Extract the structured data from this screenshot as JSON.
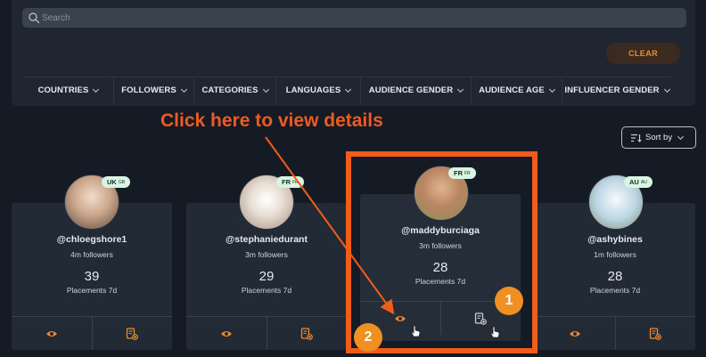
{
  "search": {
    "placeholder": "Search"
  },
  "filters": {
    "clear_label": "CLEAR",
    "items": [
      {
        "label": "COUNTRIES"
      },
      {
        "label": "FOLLOWERS"
      },
      {
        "label": "CATEGORIES"
      },
      {
        "label": "LANGUAGES"
      },
      {
        "label": "AUDIENCE GENDER"
      },
      {
        "label": "AUDIENCE AGE"
      },
      {
        "label": "INFLUENCER GENDER"
      }
    ]
  },
  "instruction": {
    "text": "Click here to view details"
  },
  "sort": {
    "label": "Sort by"
  },
  "cards": [
    {
      "handle": "@chloegshore1",
      "followers": "4m followers",
      "placements": "39",
      "placements_label": "Placements 7d",
      "country": "UK",
      "country_small": "GB",
      "avatar_colors": [
        "#caa58a",
        "#f4e9de"
      ]
    },
    {
      "handle": "@stephaniedurant",
      "followers": "3m followers",
      "placements": "29",
      "placements_label": "Placements 7d",
      "country": "FR",
      "country_small": "FR",
      "avatar_colors": [
        "#d9c7b8",
        "#f5ede6"
      ]
    },
    {
      "handle": "@maddyburciaga",
      "followers": "3m followers",
      "placements": "28",
      "placements_label": "Placements 7d",
      "country": "FR",
      "country_small": "FR",
      "avatar_colors": [
        "#c79a7a",
        "#eadbc9"
      ]
    },
    {
      "handle": "@ashybines",
      "followers": "1m followers",
      "placements": "28",
      "placements_label": "Placements 7d",
      "country": "AU",
      "country_small": "AU",
      "avatar_colors": [
        "#9fc3d8",
        "#eef3f6"
      ]
    }
  ],
  "steps": {
    "first": "1",
    "second": "2"
  },
  "colors": {
    "accent": "#f08c2e",
    "highlight": "#f25c1a",
    "badge": "#d8f4e3",
    "background": "#151b25"
  }
}
